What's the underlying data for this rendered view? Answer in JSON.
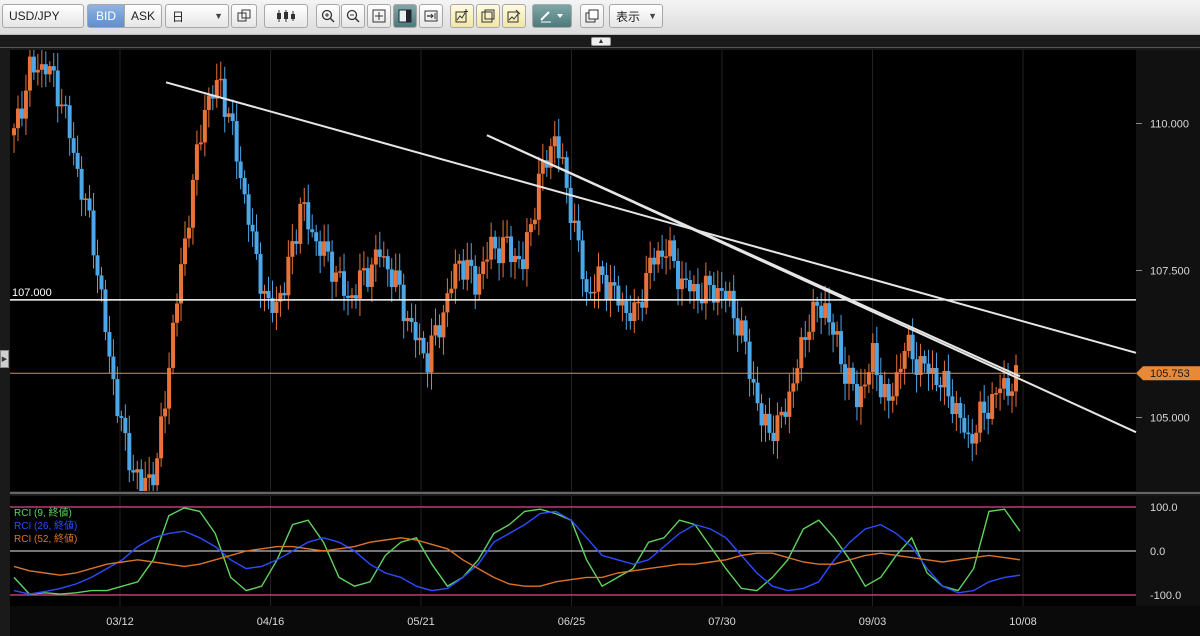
{
  "toolbar": {
    "symbol": "USD/JPY",
    "bid_label": "BID",
    "ask_label": "ASK",
    "timeframe": "日",
    "display_label": "表示",
    "icons": [
      "copy-icon",
      "candlestick-icon",
      "zoom-in-icon",
      "zoom-out-icon",
      "fit-icon",
      "panel-icon",
      "scroll-end-icon",
      "add-chart-icon",
      "chart-settings-icon",
      "indicator-icon",
      "pen-icon",
      "screenshot-icon"
    ]
  },
  "chart_data": [
    {
      "type": "candlestick",
      "title": "",
      "y_ticks": [
        "110.000",
        "107.500",
        "105.000"
      ],
      "x_ticks": [
        "03/12",
        "04/16",
        "05/21",
        "06/25",
        "07/30",
        "09/03",
        "10/08"
      ],
      "ylim": [
        103.75,
        111.25
      ],
      "grid": false,
      "horizontal_lines": [
        {
          "label": "107.000",
          "value": 107.0,
          "color": "#ffffff"
        },
        {
          "label": "105.753",
          "value": 105.753,
          "color": "#e8893a"
        }
      ],
      "trendlines": [
        {
          "from": [
            "~03/20",
            110.7
          ],
          "to": [
            "beyond 10/08",
            106.1
          ]
        },
        {
          "from": [
            "~05/29",
            109.8
          ],
          "to": [
            "beyond 10/08",
            104.75
          ]
        },
        {
          "from": [
            "~05/29",
            109.8
          ],
          "to": [
            "~10/08",
            105.7
          ]
        }
      ],
      "series": [
        {
          "values_approx": [
            109.8,
            110.9,
            111.0,
            110.4,
            109.2,
            108.0,
            106.0,
            104.5,
            103.8,
            104.2,
            106.5,
            108.5,
            110.3,
            110.7,
            109.5,
            108.0,
            106.8,
            107.2,
            108.6,
            108.0,
            107.6,
            107.0,
            107.4,
            107.8,
            107.3,
            106.5,
            106.0,
            106.8,
            107.7,
            107.3,
            107.9,
            107.9,
            107.6,
            109.0,
            109.8,
            108.6,
            107.1,
            107.4,
            107.0,
            106.7,
            107.6,
            107.9,
            107.3,
            107.1,
            107.2,
            107.0,
            106.2,
            104.9,
            104.8,
            105.6,
            106.7,
            106.9,
            106.0,
            105.3,
            106.0,
            105.2,
            106.2,
            105.9,
            105.7,
            105.3,
            104.6,
            105.1,
            105.5,
            105.6
          ]
        }
      ]
    },
    {
      "type": "line",
      "title": "",
      "y_ticks": [
        "100.0",
        "0.0",
        "-100.0"
      ],
      "ylim": [
        -125,
        125
      ],
      "legend_position": "top-left",
      "horizontal_lines": [
        100,
        0,
        -100
      ],
      "series": [
        {
          "name": "RCI (9, 終値)",
          "color": "#5fd35f",
          "values": [
            -60,
            -98,
            -95,
            -98,
            -95,
            -90,
            -90,
            -80,
            -70,
            -20,
            80,
            98,
            90,
            40,
            -60,
            -90,
            -80,
            -20,
            60,
            70,
            20,
            -60,
            -80,
            -70,
            -10,
            20,
            30,
            -30,
            -80,
            -60,
            -20,
            40,
            60,
            90,
            95,
            85,
            70,
            -20,
            -80,
            -60,
            -40,
            20,
            30,
            70,
            60,
            10,
            -40,
            -85,
            -90,
            -60,
            -20,
            50,
            70,
            30,
            -20,
            -80,
            -60,
            -10,
            30,
            -50,
            -80,
            -90,
            -40,
            90,
            95,
            45
          ]
        },
        {
          "name": "RCI (26, 終値)",
          "color": "#2d4bff",
          "values": [
            -90,
            -98,
            -92,
            -85,
            -75,
            -60,
            -40,
            -20,
            10,
            30,
            40,
            45,
            30,
            10,
            -20,
            -40,
            -35,
            -20,
            0,
            20,
            30,
            20,
            0,
            -30,
            -50,
            -60,
            -80,
            -90,
            -85,
            -60,
            -30,
            20,
            40,
            60,
            85,
            90,
            70,
            30,
            -10,
            -20,
            -30,
            -20,
            10,
            40,
            60,
            50,
            30,
            -10,
            -50,
            -80,
            -90,
            -85,
            -70,
            -20,
            20,
            50,
            60,
            40,
            10,
            -40,
            -80,
            -95,
            -90,
            -70,
            -60,
            -55
          ]
        },
        {
          "name": "RCI (52, 終値)",
          "color": "#d9742a",
          "values": [
            -35,
            -45,
            -50,
            -55,
            -50,
            -40,
            -30,
            -25,
            -20,
            -25,
            -30,
            -35,
            -30,
            -20,
            -10,
            0,
            5,
            10,
            10,
            5,
            0,
            5,
            10,
            20,
            25,
            30,
            25,
            15,
            5,
            -20,
            -40,
            -60,
            -75,
            -80,
            -80,
            -70,
            -65,
            -60,
            -60,
            -50,
            -45,
            -40,
            -35,
            -30,
            -30,
            -25,
            -20,
            -10,
            -5,
            -5,
            -15,
            -25,
            -30,
            -30,
            -20,
            -10,
            -5,
            -10,
            -15,
            -20,
            -25,
            -20,
            -15,
            -10,
            -15,
            -20
          ]
        }
      ]
    }
  ],
  "colors": {
    "up": "#e8733a",
    "down": "#4da6e6",
    "background": "#000000",
    "grid": "#222222",
    "band": "#d94a8c",
    "axis_text": "#d8d8d8"
  }
}
